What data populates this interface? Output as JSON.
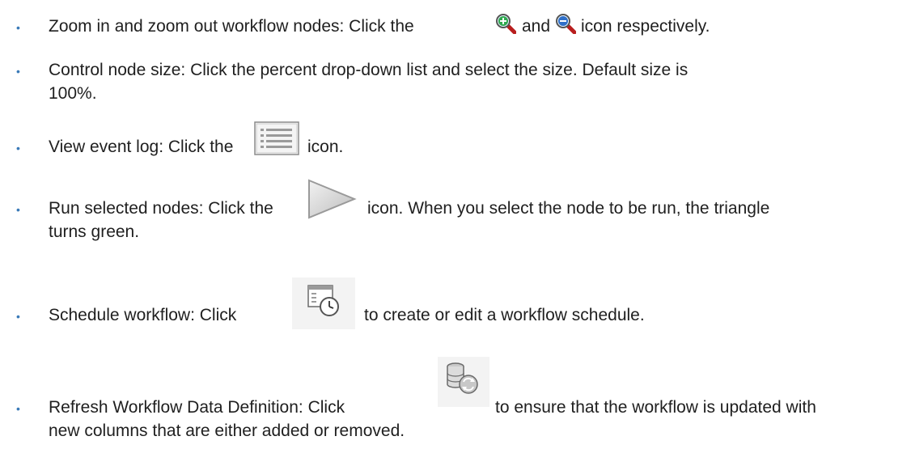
{
  "items": [
    {
      "part1": "Zoom in and zoom out workflow nodes: Click the",
      "part2": "and",
      "part3": "icon respectively.",
      "icon1": "zoom-in-icon",
      "icon2": "zoom-out-icon"
    },
    {
      "line1": "Control node size: Click the percent drop-down list and select the size. Default size is",
      "line2": "100%."
    },
    {
      "part1": "View event log: Click the",
      "part2": "icon.",
      "icon": "event-log-icon"
    },
    {
      "part1": "Run selected nodes: Click the",
      "part2": "icon. When you select the node to be run, the triangle",
      "line2": "turns green.",
      "icon": "run-triangle-icon"
    },
    {
      "part1": "Schedule workflow: Click",
      "part2": "to create or edit a workflow schedule.",
      "icon": "schedule-icon"
    },
    {
      "part1": "Refresh Workflow Data Definition: Click",
      "part2": "to ensure that the workflow is updated with",
      "line2": "new columns that are either added or removed.",
      "icon": "refresh-data-definition-icon"
    }
  ],
  "bullet_glyph": "•",
  "colors": {
    "bullet": "#3a7ab8",
    "text": "#1f1f1f",
    "zoom_in_plus": "#2fa84f",
    "zoom_out_minus": "#2f6fc8",
    "magnifier_handle": "#b81e1e"
  }
}
